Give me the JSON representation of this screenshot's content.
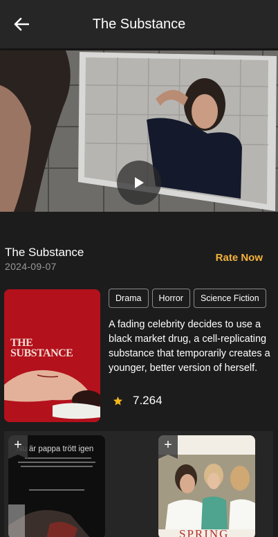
{
  "appbar": {
    "title": "The Substance",
    "back_icon": "arrow-left-icon"
  },
  "trailer": {
    "play_icon": "play-icon"
  },
  "movie": {
    "title": "The Substance",
    "release_date": "2024-09-07",
    "rate_label": "Rate Now",
    "genres": [
      "Drama",
      "Horror",
      "Science Fiction"
    ],
    "overview": "A fading celebrity decides to use a black market drug, a cell-replicating substance that temporarily creates a younger, better version of herself.",
    "rating": "7.264",
    "rating_icon": "star-icon",
    "poster_title": "THE SUBSTANCE"
  },
  "recommendations": [
    {
      "title": "Nu är pappa trött igen",
      "add_label": "+"
    },
    {
      "title": "SPRING",
      "add_label": "+"
    }
  ],
  "colors": {
    "background": "#1c1c1c",
    "appbar": "#262626",
    "accent": "#f4b23c",
    "star": "#f5b81c"
  }
}
